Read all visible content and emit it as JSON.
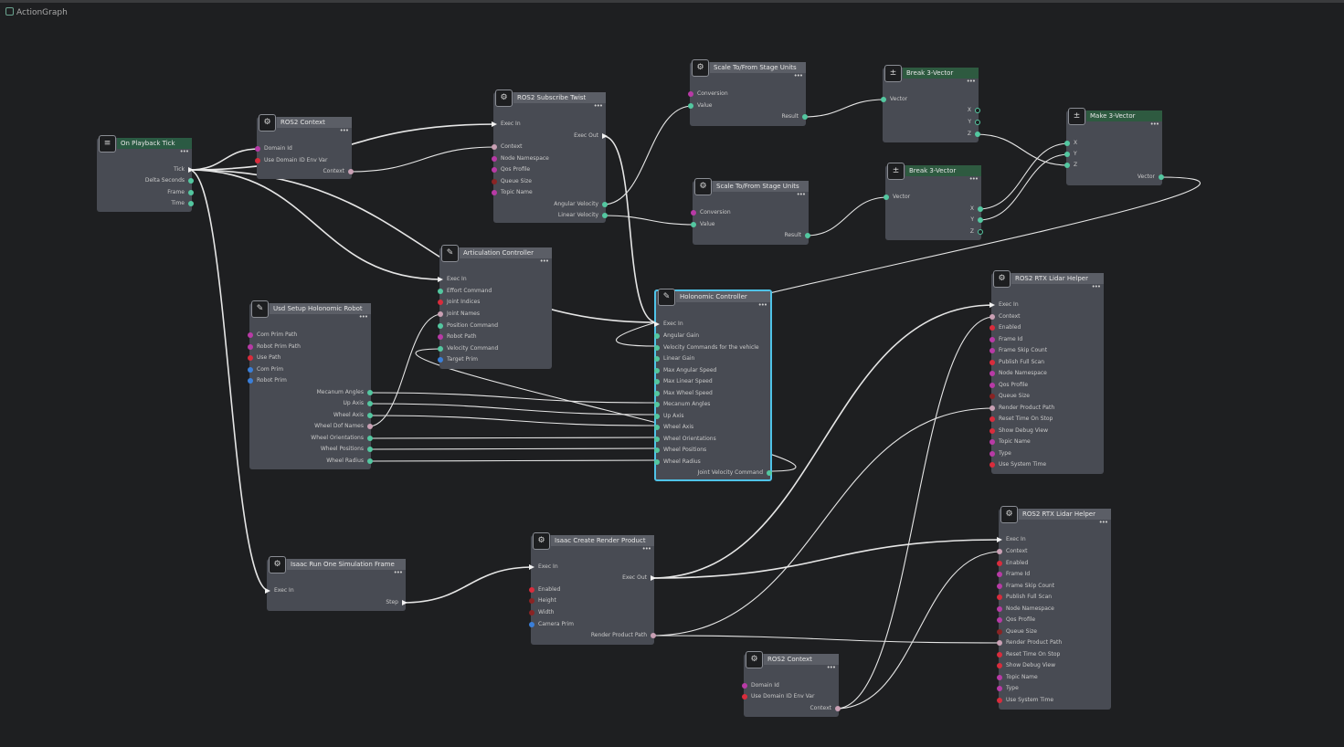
{
  "tab": {
    "title": "ActionGraph"
  },
  "colors": {
    "background": "#1e1f21",
    "node_body": "#484b53",
    "node_header": "#5b5e66",
    "event_header": "#2b5a43",
    "selected_border": "#4fc3e8",
    "wire": "#e6e6e6",
    "pin_green": "#53c7a0",
    "pin_pink": "#c9a0b4",
    "pin_magenta": "#b83aa6",
    "pin_red": "#d92c3c",
    "pin_blue": "#3a7fd9",
    "pin_darkred": "#8a2424"
  },
  "nodes": [
    {
      "id": "tick",
      "title": "On Playback Tick",
      "icon": "signal-icon",
      "style": "ev",
      "pins": [
        {
          "name": "Tick",
          "dir": "out",
          "type": "exec"
        },
        {
          "name": "Delta Seconds",
          "dir": "out",
          "type": "green"
        },
        {
          "name": "Frame",
          "dir": "out",
          "type": "green"
        },
        {
          "name": "Time",
          "dir": "out",
          "type": "green"
        }
      ]
    },
    {
      "id": "ctx1",
      "title": "ROS2 Context",
      "icon": "ros-icon",
      "pins": [
        {
          "name": "Domain Id",
          "dir": "in",
          "type": "magenta"
        },
        {
          "name": "Use Domain ID Env Var",
          "dir": "in",
          "type": "red"
        },
        {
          "name": "Context",
          "dir": "out",
          "type": "pink"
        }
      ]
    },
    {
      "id": "sub",
      "title": "ROS2 Subscribe Twist",
      "icon": "ros-icon",
      "pins": [
        {
          "name": "Exec In",
          "dir": "in",
          "type": "exec"
        },
        {
          "name": "Exec Out",
          "dir": "out",
          "type": "exec"
        },
        {
          "name": "Context",
          "dir": "in",
          "type": "pink"
        },
        {
          "name": "Node Namespace",
          "dir": "in",
          "type": "magenta"
        },
        {
          "name": "Qos Profile",
          "dir": "in",
          "type": "magenta"
        },
        {
          "name": "Queue Size",
          "dir": "in",
          "type": "darkred"
        },
        {
          "name": "Topic Name",
          "dir": "in",
          "type": "magenta"
        },
        {
          "name": "Angular Velocity",
          "dir": "out",
          "type": "green"
        },
        {
          "name": "Linear Velocity",
          "dir": "out",
          "type": "green"
        }
      ]
    },
    {
      "id": "sc1",
      "title": "Scale To/From Stage Units",
      "icon": "ros-icon",
      "pins": [
        {
          "name": "Conversion",
          "dir": "in",
          "type": "magenta"
        },
        {
          "name": "Value",
          "dir": "in",
          "type": "green"
        },
        {
          "name": "Result",
          "dir": "out",
          "type": "green"
        }
      ]
    },
    {
      "id": "sc2",
      "title": "Scale To/From Stage Units",
      "icon": "ros-icon",
      "pins": [
        {
          "name": "Conversion",
          "dir": "in",
          "type": "magenta"
        },
        {
          "name": "Value",
          "dir": "in",
          "type": "green"
        },
        {
          "name": "Result",
          "dir": "out",
          "type": "green"
        }
      ]
    },
    {
      "id": "br1",
      "title": "Break 3-Vector",
      "icon": "math-icon",
      "style": "mth",
      "pins": [
        {
          "name": "Vector",
          "dir": "in",
          "type": "green"
        },
        {
          "name": "X",
          "dir": "out",
          "type": "hollow"
        },
        {
          "name": "Y",
          "dir": "out",
          "type": "hollow"
        },
        {
          "name": "Z",
          "dir": "out",
          "type": "green"
        }
      ]
    },
    {
      "id": "br2",
      "title": "Break 3-Vector",
      "icon": "math-icon",
      "style": "mth",
      "pins": [
        {
          "name": "Vector",
          "dir": "in",
          "type": "green"
        },
        {
          "name": "X",
          "dir": "out",
          "type": "green"
        },
        {
          "name": "Y",
          "dir": "out",
          "type": "green"
        },
        {
          "name": "Z",
          "dir": "out",
          "type": "hollow"
        }
      ]
    },
    {
      "id": "mk",
      "title": "Make 3-Vector",
      "icon": "math-icon",
      "style": "mth",
      "pins": [
        {
          "name": "X",
          "dir": "in",
          "type": "green"
        },
        {
          "name": "Y",
          "dir": "in",
          "type": "green"
        },
        {
          "name": "Z",
          "dir": "in",
          "type": "green"
        },
        {
          "name": "Vector",
          "dir": "out",
          "type": "green"
        }
      ]
    },
    {
      "id": "art",
      "title": "Articulation Controller",
      "icon": "script-icon",
      "pins": [
        {
          "name": "Exec In",
          "dir": "in",
          "type": "exec"
        },
        {
          "name": "Effort Command",
          "dir": "in",
          "type": "green"
        },
        {
          "name": "Joint Indices",
          "dir": "in",
          "type": "red"
        },
        {
          "name": "Joint Names",
          "dir": "in",
          "type": "pink"
        },
        {
          "name": "Position Command",
          "dir": "in",
          "type": "green"
        },
        {
          "name": "Robot Path",
          "dir": "in",
          "type": "magenta"
        },
        {
          "name": "Velocity Command",
          "dir": "in",
          "type": "green"
        },
        {
          "name": "Target Prim",
          "dir": "in",
          "type": "blue"
        }
      ]
    },
    {
      "id": "usd",
      "title": "Usd Setup Holonomic Robot",
      "icon": "script-icon",
      "pins": [
        {
          "name": "Com Prim Path",
          "dir": "in",
          "type": "magenta"
        },
        {
          "name": "Robot Prim Path",
          "dir": "in",
          "type": "magenta"
        },
        {
          "name": "Use Path",
          "dir": "in",
          "type": "red"
        },
        {
          "name": "Com Prim",
          "dir": "in",
          "type": "blue"
        },
        {
          "name": "Robot Prim",
          "dir": "in",
          "type": "blue"
        },
        {
          "name": "Mecanum Angles",
          "dir": "out",
          "type": "green"
        },
        {
          "name": "Up Axis",
          "dir": "out",
          "type": "green"
        },
        {
          "name": "Wheel Axis",
          "dir": "out",
          "type": "green"
        },
        {
          "name": "Wheel Dof Names",
          "dir": "out",
          "type": "pink"
        },
        {
          "name": "Wheel Orientations",
          "dir": "out",
          "type": "green"
        },
        {
          "name": "Wheel Positions",
          "dir": "out",
          "type": "green"
        },
        {
          "name": "Wheel Radius",
          "dir": "out",
          "type": "green"
        }
      ]
    },
    {
      "id": "holo",
      "title": "Holonomic Controller",
      "icon": "script-icon",
      "selected": true,
      "pins": [
        {
          "name": "Exec In",
          "dir": "in",
          "type": "exec"
        },
        {
          "name": "Angular Gain",
          "dir": "in",
          "type": "green"
        },
        {
          "name": "Velocity Commands for the vehicle",
          "dir": "in",
          "type": "green"
        },
        {
          "name": "Linear Gain",
          "dir": "in",
          "type": "green"
        },
        {
          "name": "Max Angular Speed",
          "dir": "in",
          "type": "green"
        },
        {
          "name": "Max Linear Speed",
          "dir": "in",
          "type": "green"
        },
        {
          "name": "Max Wheel Speed",
          "dir": "in",
          "type": "green"
        },
        {
          "name": "Mecanum Angles",
          "dir": "in",
          "type": "green"
        },
        {
          "name": "Up Axis",
          "dir": "in",
          "type": "green"
        },
        {
          "name": "Wheel Axis",
          "dir": "in",
          "type": "green"
        },
        {
          "name": "Wheel Orientations",
          "dir": "in",
          "type": "green"
        },
        {
          "name": "Wheel Positions",
          "dir": "in",
          "type": "green"
        },
        {
          "name": "Wheel Radius",
          "dir": "in",
          "type": "green"
        },
        {
          "name": "Joint Velocity Command",
          "dir": "out",
          "type": "green"
        }
      ]
    },
    {
      "id": "run",
      "title": "Isaac Run One Simulation Frame",
      "icon": "ros-icon",
      "pins": [
        {
          "name": "Exec In",
          "dir": "in",
          "type": "exec"
        },
        {
          "name": "Step",
          "dir": "out",
          "type": "exec"
        }
      ]
    },
    {
      "id": "rp",
      "title": "Isaac Create Render Product",
      "icon": "ros-icon",
      "pins": [
        {
          "name": "Exec In",
          "dir": "in",
          "type": "exec"
        },
        {
          "name": "Exec Out",
          "dir": "out",
          "type": "exec"
        },
        {
          "name": "Enabled",
          "dir": "in",
          "type": "red"
        },
        {
          "name": "Height",
          "dir": "in",
          "type": "darkred"
        },
        {
          "name": "Width",
          "dir": "in",
          "type": "darkred"
        },
        {
          "name": "Camera Prim",
          "dir": "in",
          "type": "blue"
        },
        {
          "name": "Render Product Path",
          "dir": "out",
          "type": "pink"
        }
      ]
    },
    {
      "id": "ctx2",
      "title": "ROS2 Context",
      "icon": "ros-icon",
      "pins": [
        {
          "name": "Domain Id",
          "dir": "in",
          "type": "magenta"
        },
        {
          "name": "Use Domain ID Env Var",
          "dir": "in",
          "type": "red"
        },
        {
          "name": "Context",
          "dir": "out",
          "type": "pink"
        }
      ]
    },
    {
      "id": "lid1",
      "title": "ROS2 RTX Lidar Helper",
      "icon": "ros-icon",
      "pins": [
        {
          "name": "Exec In",
          "dir": "in",
          "type": "exec"
        },
        {
          "name": "Context",
          "dir": "in",
          "type": "pink"
        },
        {
          "name": "Enabled",
          "dir": "in",
          "type": "red"
        },
        {
          "name": "Frame Id",
          "dir": "in",
          "type": "magenta"
        },
        {
          "name": "Frame Skip Count",
          "dir": "in",
          "type": "magenta"
        },
        {
          "name": "Publish Full Scan",
          "dir": "in",
          "type": "red"
        },
        {
          "name": "Node Namespace",
          "dir": "in",
          "type": "magenta"
        },
        {
          "name": "Qos Profile",
          "dir": "in",
          "type": "magenta"
        },
        {
          "name": "Queue Size",
          "dir": "in",
          "type": "darkred"
        },
        {
          "name": "Render Product Path",
          "dir": "in",
          "type": "pink"
        },
        {
          "name": "Reset Time On Stop",
          "dir": "in",
          "type": "red"
        },
        {
          "name": "Show Debug View",
          "dir": "in",
          "type": "red"
        },
        {
          "name": "Topic Name",
          "dir": "in",
          "type": "magenta"
        },
        {
          "name": "Type",
          "dir": "in",
          "type": "magenta"
        },
        {
          "name": "Use System Time",
          "dir": "in",
          "type": "red"
        }
      ]
    },
    {
      "id": "lid2",
      "title": "ROS2 RTX Lidar Helper",
      "icon": "ros-icon",
      "pins": [
        {
          "name": "Exec In",
          "dir": "in",
          "type": "exec"
        },
        {
          "name": "Context",
          "dir": "in",
          "type": "pink"
        },
        {
          "name": "Enabled",
          "dir": "in",
          "type": "red"
        },
        {
          "name": "Frame Id",
          "dir": "in",
          "type": "magenta"
        },
        {
          "name": "Frame Skip Count",
          "dir": "in",
          "type": "magenta"
        },
        {
          "name": "Publish Full Scan",
          "dir": "in",
          "type": "red"
        },
        {
          "name": "Node Namespace",
          "dir": "in",
          "type": "magenta"
        },
        {
          "name": "Qos Profile",
          "dir": "in",
          "type": "magenta"
        },
        {
          "name": "Queue Size",
          "dir": "in",
          "type": "darkred"
        },
        {
          "name": "Render Product Path",
          "dir": "in",
          "type": "pink"
        },
        {
          "name": "Reset Time On Stop",
          "dir": "in",
          "type": "red"
        },
        {
          "name": "Show Debug View",
          "dir": "in",
          "type": "red"
        },
        {
          "name": "Topic Name",
          "dir": "in",
          "type": "magenta"
        },
        {
          "name": "Type",
          "dir": "in",
          "type": "magenta"
        },
        {
          "name": "Use System Time",
          "dir": "in",
          "type": "red"
        }
      ]
    }
  ],
  "connections": [
    [
      "tick",
      "Tick",
      "ctx1",
      "Domain Id"
    ],
    [
      "tick",
      "Tick",
      "sub",
      "Exec In"
    ],
    [
      "tick",
      "Tick",
      "art",
      "Exec In"
    ],
    [
      "tick",
      "Tick",
      "holo",
      "Exec In"
    ],
    [
      "tick",
      "Tick",
      "run",
      "Exec In"
    ],
    [
      "ctx1",
      "Context",
      "sub",
      "Context"
    ],
    [
      "sub",
      "Exec Out",
      "holo",
      "Exec In"
    ],
    [
      "sub",
      "Angular Velocity",
      "sc1",
      "Value"
    ],
    [
      "sub",
      "Linear Velocity",
      "sc2",
      "Value"
    ],
    [
      "sc1",
      "Result",
      "br1",
      "Vector"
    ],
    [
      "sc2",
      "Result",
      "br2",
      "Vector"
    ],
    [
      "br1",
      "Z",
      "mk",
      "Z"
    ],
    [
      "br2",
      "X",
      "mk",
      "X"
    ],
    [
      "br2",
      "Y",
      "mk",
      "Y"
    ],
    [
      "mk",
      "Vector",
      "holo",
      "Velocity Commands for the vehicle"
    ],
    [
      "usd",
      "Mecanum Angles",
      "holo",
      "Mecanum Angles"
    ],
    [
      "usd",
      "Up Axis",
      "holo",
      "Up Axis"
    ],
    [
      "usd",
      "Wheel Axis",
      "holo",
      "Wheel Axis"
    ],
    [
      "usd",
      "Wheel Orientations",
      "holo",
      "Wheel Orientations"
    ],
    [
      "usd",
      "Wheel Positions",
      "holo",
      "Wheel Positions"
    ],
    [
      "usd",
      "Wheel Radius",
      "holo",
      "Wheel Radius"
    ],
    [
      "usd",
      "Wheel Dof Names",
      "art",
      "Joint Names"
    ],
    [
      "holo",
      "Joint Velocity Command",
      "art",
      "Velocity Command"
    ],
    [
      "run",
      "Step",
      "rp",
      "Exec In"
    ],
    [
      "rp",
      "Exec Out",
      "lid1",
      "Exec In"
    ],
    [
      "rp",
      "Exec Out",
      "lid2",
      "Exec In"
    ],
    [
      "rp",
      "Render Product Path",
      "lid1",
      "Render Product Path"
    ],
    [
      "rp",
      "Render Product Path",
      "lid2",
      "Render Product Path"
    ],
    [
      "ctx2",
      "Context",
      "lid1",
      "Context"
    ],
    [
      "ctx2",
      "Context",
      "lid2",
      "Context"
    ]
  ]
}
